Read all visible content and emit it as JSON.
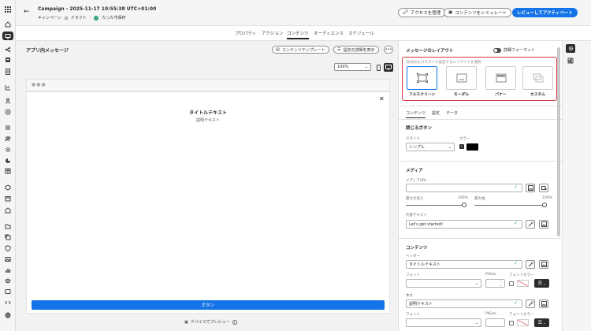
{
  "header": {
    "title": "Campaign - 2025-11-17 10:55:38 UTC+01:00",
    "channel": "キャンペーン",
    "status": "ドラフト",
    "saved": "たった今保存",
    "btn_access": "アクセスを管理",
    "btn_simulate": "コンテンツをシミュレート",
    "btn_review": "レビューしてアクティベート"
  },
  "tabs": [
    "プロパティ",
    "アクション",
    "コンテンツ",
    "オーディエンス",
    "スケジュール"
  ],
  "canvas": {
    "title": "アプリ内メッセージ",
    "btn_template": "コンテンツテンプレート",
    "btn_settings": "設定の詳細を表示",
    "zoom": "100%",
    "msg_title": "タイトルテキスト",
    "msg_desc": "説明テキスト",
    "msg_button": "ボタン",
    "device_preview": "デバイスでプレビュー"
  },
  "panel": {
    "layout_title": "メッセージのレイアウト",
    "advanced_format": "詳細フォーマット",
    "layout_hint": "形式およびスタイル設定するレイアウトを選択",
    "layouts": [
      "フルスクリーン",
      "モーダル",
      "バナー",
      "カスタム"
    ],
    "subtabs": [
      "コンテンツ",
      "設定",
      "データ"
    ],
    "close_btn": {
      "title": "閉じるボタン",
      "style_label": "スタイル",
      "color_label": "カラー",
      "style_value": "シンプル",
      "color": "#000000"
    },
    "media": {
      "title": "メディア",
      "url_label": "メディアURL",
      "height_label": "最大の高さ",
      "height_value": "100%",
      "width_label": "最大幅",
      "width_value": "100%",
      "alt_label": "代替テキスト",
      "alt_value": "Let's get started!"
    },
    "content": {
      "title": "コンテンツ",
      "header_label": "ヘッダー",
      "header_value": "タイトルテキスト",
      "font_label": "フォント",
      "size_label": "PtSize",
      "fontcolor_label": "フォントカラー",
      "body_label": "本文",
      "body_value": "説明テキスト"
    }
  },
  "colors": {
    "accent": "#1473e6",
    "ok": "#2d9d78",
    "layout_border": "#d7373f"
  }
}
